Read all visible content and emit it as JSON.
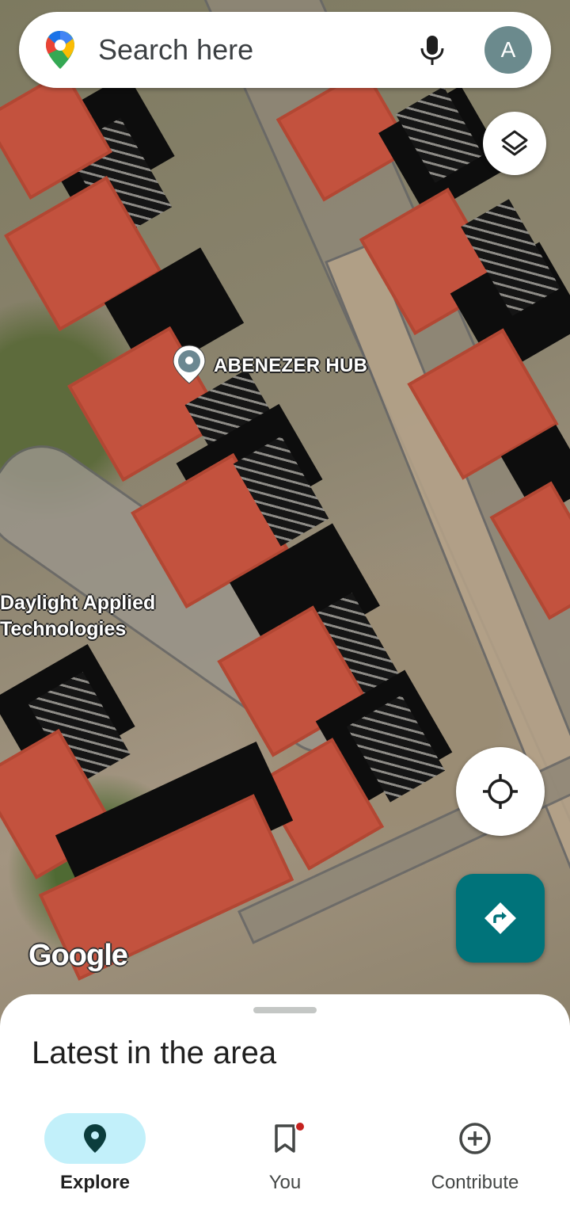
{
  "search": {
    "placeholder": "Search here"
  },
  "account": {
    "avatar_letter": "A"
  },
  "map": {
    "places": [
      {
        "label": "ABENEZER HUB"
      },
      {
        "label_line1": "Daylight Applied",
        "label_line2": "Technologies"
      }
    ],
    "attribution": "Google",
    "view": "satellite"
  },
  "bottom_sheet": {
    "title": "Latest in the area"
  },
  "nav": {
    "items": [
      {
        "label": "Explore",
        "icon": "explore-pin-icon",
        "active": true
      },
      {
        "label": "You",
        "icon": "bookmark-icon",
        "badge": true
      },
      {
        "label": "Contribute",
        "icon": "add-circle-icon"
      }
    ]
  },
  "colors": {
    "accent": "#00737a",
    "active_nav_pill": "#c2f0fa",
    "badge": "#c5221f"
  }
}
